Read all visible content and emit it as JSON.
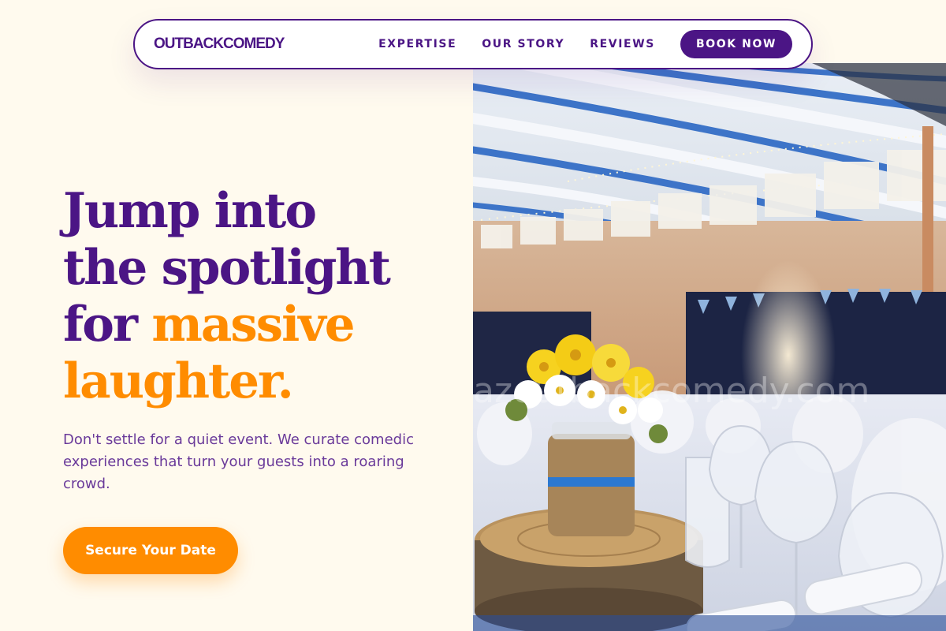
{
  "nav": {
    "logo": "OUTBACKCOMEDY",
    "links": [
      "EXPERTISE",
      "OUR STORY",
      "REVIEWS"
    ],
    "cta_label": "BOOK NOW"
  },
  "hero": {
    "title_line1": "Jump into",
    "title_line2": "the spotlight",
    "title_line3_plain": "for",
    "title_line3_accent": "massive",
    "title_line4_accent": "laughter.",
    "subtitle": "Don't settle for a quiet event. We curate comedic experiences that turn your guests into a roaring crowd.",
    "cta_label": "Secure Your Date"
  },
  "image": {
    "subject": "banquet hall with white draped tables, glassware, a burlap-wrapped jar of yellow and white daisies on a wood slice, blue and white ceiling streamers and bunting",
    "watermark": "azoutbackcomedy.com"
  },
  "colors": {
    "background": "#fffaee",
    "primary": "#4b1585",
    "accent": "#ff8c00",
    "body_text": "#6a3a9a",
    "white": "#ffffff"
  }
}
